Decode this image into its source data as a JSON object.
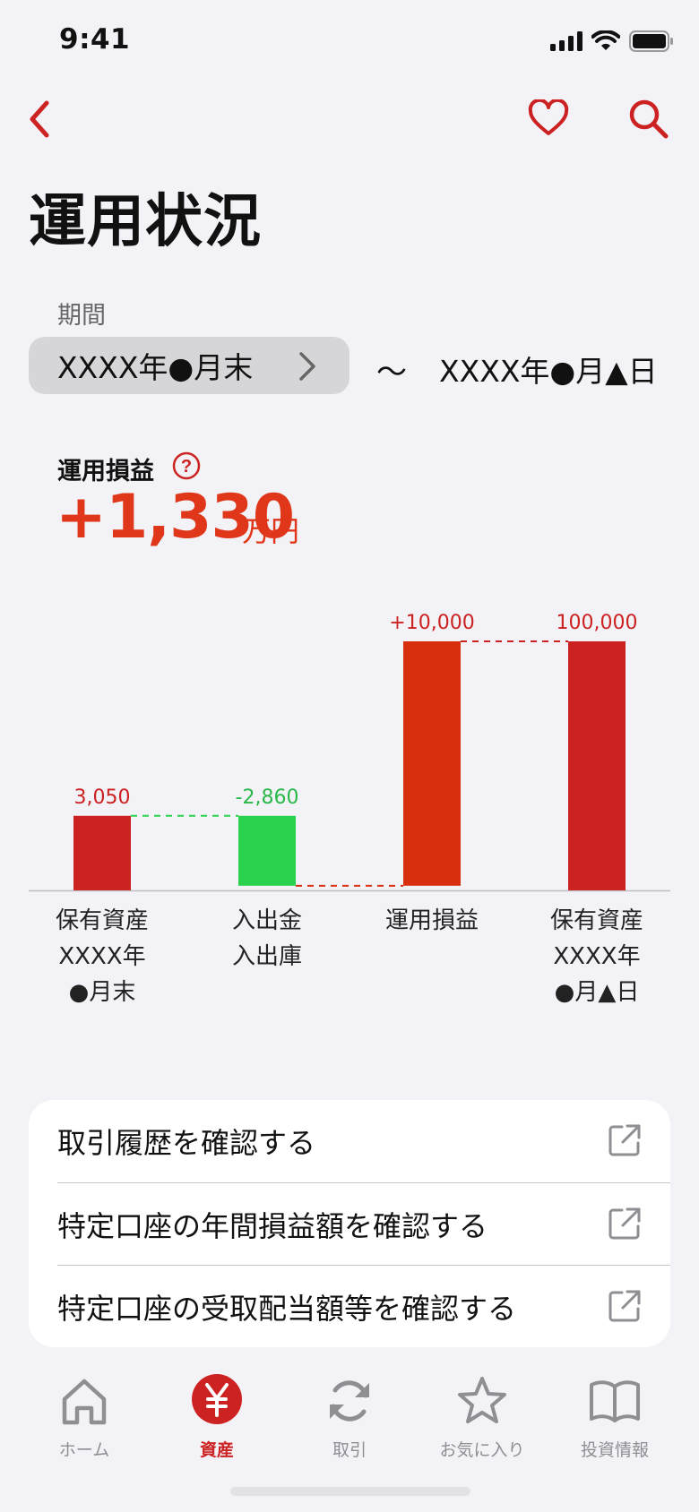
{
  "status_bar": {
    "time": "9:41"
  },
  "header": {
    "title": "運用状況"
  },
  "period": {
    "label": "期間",
    "start": "XXXX年●月末",
    "separator": "〜",
    "end": "XXXX年●月▲日"
  },
  "pnl": {
    "label": "運用損益",
    "value": "+1,330",
    "unit": "万円"
  },
  "colors": {
    "accent": "#cc2222",
    "pnl": "#e0361a",
    "negative": "#2ad14c",
    "tab_inactive": "#8e8e93"
  },
  "chart_data": {
    "type": "waterfall",
    "categories": [
      "保有資産\nXXXX年\n●月末",
      "入出金\n入出庫",
      "運用損益",
      "保有資産\nXXXX年\n●月▲日"
    ],
    "value_labels": [
      "3,050",
      "-2,860",
      "+10,000",
      "100,000"
    ],
    "bars": [
      {
        "kind": "total",
        "start": 0,
        "end": 3050,
        "color": "#cc2222"
      },
      {
        "kind": "delta",
        "start": 3050,
        "end": 190,
        "color": "#2ad14c"
      },
      {
        "kind": "delta",
        "start": 190,
        "end": 10190,
        "color": "#d8300f"
      },
      {
        "kind": "total",
        "start": 0,
        "end": 10190,
        "color": "#cc2222"
      }
    ]
  },
  "links": [
    {
      "label": "取引履歴を確認する"
    },
    {
      "label": "特定口座の年間損益額を確認する"
    },
    {
      "label": "特定口座の受取配当額等を確認する"
    }
  ],
  "tabs": [
    {
      "label": "ホーム",
      "icon": "home-icon",
      "active": false
    },
    {
      "label": "資産",
      "icon": "yen-icon",
      "active": true
    },
    {
      "label": "取引",
      "icon": "refresh-icon",
      "active": false
    },
    {
      "label": "お気に入り",
      "icon": "star-icon",
      "active": false
    },
    {
      "label": "投資情報",
      "icon": "book-icon",
      "active": false
    }
  ]
}
